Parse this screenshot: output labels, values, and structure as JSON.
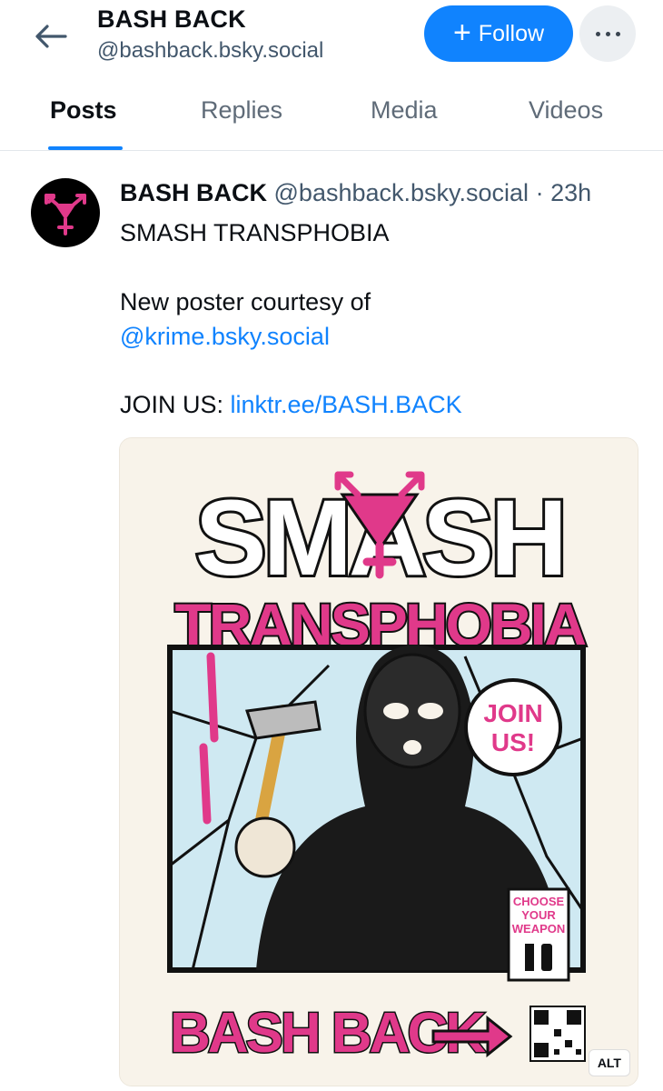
{
  "header": {
    "title": "BASH BACK",
    "handle": "@bashback.bsky.social",
    "follow_label": "Follow",
    "colors": {
      "accent": "#1083fe"
    }
  },
  "tabs": [
    {
      "label": "Posts",
      "active": true
    },
    {
      "label": "Replies",
      "active": false
    },
    {
      "label": "Media",
      "active": false
    },
    {
      "label": "Videos",
      "active": false
    }
  ],
  "post": {
    "author_name": "BASH BACK",
    "author_handle": "@bashback.bsky.social",
    "separator": "·",
    "time": "23h",
    "line1": "SMASH TRANSPHOBIA",
    "line2": "New poster courtesy of",
    "mention": "@krime.bsky.social",
    "join_label": "JOIN US:",
    "join_link": "linktr.ee/BASH.BACK",
    "alt_badge": "ALT",
    "poster": {
      "headline": "SMASH",
      "subhead": "TRANSPHOBIA",
      "bubble": [
        "JOIN",
        "US!"
      ],
      "sign": [
        "CHOOSE",
        "YOUR",
        "WEAPON"
      ],
      "footer": "BASH BACK",
      "colors": {
        "pink": "#e0398a",
        "ink": "#111111",
        "ice": "#cfe9f2",
        "paper": "#f8f3ea"
      }
    }
  }
}
